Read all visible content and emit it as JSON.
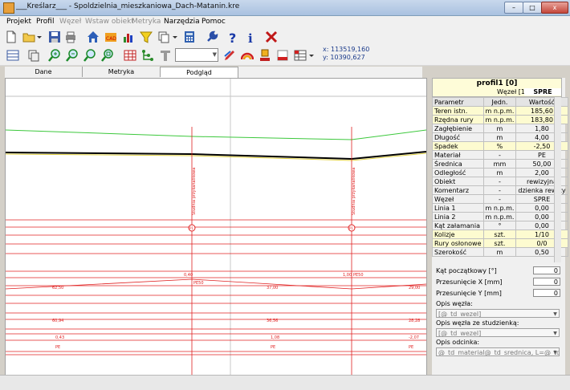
{
  "window": {
    "title": "___Kreślarz___ - Spoldzielnia_mieszkaniowa_Dach-Matanin.kre",
    "controls": {
      "minimize": "–",
      "maximize": "□",
      "close": "x"
    }
  },
  "menu": [
    {
      "label": "Projekt",
      "enabled": true
    },
    {
      "label": "Profil",
      "enabled": true
    },
    {
      "label": "Węzeł",
      "enabled": false
    },
    {
      "label": "Wstaw obiekt",
      "enabled": false
    },
    {
      "label": "Metryka",
      "enabled": false
    },
    {
      "label": "Narzędzia",
      "enabled": true
    },
    {
      "label": "Pomoc",
      "enabled": true
    }
  ],
  "toolbar1_icons": [
    "new-file-icon",
    "open-folder-icon",
    "dropdown-arrow-icon",
    "save-icon",
    "print-icon",
    "home-icon",
    "cad-icon",
    "bar-chart-icon",
    "filter-funnel-icon",
    "copy-pages-icon",
    "dropdown-arrow-icon",
    "calculator-icon",
    "wrench-icon",
    "help-question-icon",
    "info-icon",
    "delete-x-icon"
  ],
  "toolbar2_icons": [
    "layers-list-icon",
    "window-copy-icon",
    "zoom-in-icon",
    "zoom-out-icon",
    "zoom-fit-icon",
    "zoom-window-icon",
    "table-grid-icon",
    "network-nodes-icon",
    "pipe-t-icon",
    "layer-select-combo",
    "pen-marker-icon",
    "rainbow-icon",
    "node-pin-icon",
    "red-box-icon",
    "red-box-2-icon",
    "grid-settings-icon",
    "dropdown-arrow-icon"
  ],
  "coords": {
    "x": "x: 113519,160",
    "y": "y: 10390,627"
  },
  "tabs": [
    "Dane",
    "Metryka",
    "Podgląd"
  ],
  "profile": {
    "title": "profil1 [0]",
    "node_label": "Węzeł [1]:",
    "node_value": "SPRE",
    "columns": [
      "Parametr",
      "Jedn.",
      "Wartość"
    ],
    "rows": [
      {
        "name": "Teren istn.",
        "unit": "m n.p.m.",
        "value": "185,60",
        "highlight": true
      },
      {
        "name": "Rzędna rury",
        "unit": "m n.p.m.",
        "value": "183,80",
        "highlight": true
      },
      {
        "name": "Zagłębienie",
        "unit": "m",
        "value": "1,80",
        "highlight": false
      },
      {
        "name": "Długość",
        "unit": "m",
        "value": "4,00",
        "highlight": false
      },
      {
        "name": "Spadek",
        "unit": "%",
        "value": "-2,50",
        "highlight": true
      },
      {
        "name": "Materiał",
        "unit": "-",
        "value": "PE",
        "highlight": false
      },
      {
        "name": "Średnica",
        "unit": "mm",
        "value": "50,00",
        "highlight": false
      },
      {
        "name": "Odległość",
        "unit": "m",
        "value": "2,00",
        "highlight": false
      },
      {
        "name": "Obiekt",
        "unit": "-",
        "value": "rewizyjna",
        "highlight": false
      },
      {
        "name": "Komentarz",
        "unit": "-",
        "value": "dzienka rewizy",
        "highlight": false
      },
      {
        "name": "Węzeł",
        "unit": "-",
        "value": "SPRE",
        "highlight": false
      },
      {
        "name": "Linia 1",
        "unit": "m n.p.m.",
        "value": "0,00",
        "highlight": false
      },
      {
        "name": "Linia 2",
        "unit": "m n.p.m.",
        "value": "0,00",
        "highlight": false
      },
      {
        "name": "Kąt załamania",
        "unit": "°",
        "value": "0,00",
        "highlight": false
      },
      {
        "name": "Kolizje",
        "unit": "szt.",
        "value": "1/10",
        "highlight": true
      },
      {
        "name": "Rury osłonowe",
        "unit": "szt.",
        "value": "0/0",
        "highlight": true
      },
      {
        "name": "Szerokość",
        "unit": "m",
        "value": "0,50",
        "highlight": false
      }
    ]
  },
  "form": {
    "start_angle": {
      "label": "Kąt początkowy [°]",
      "value": "0"
    },
    "shift_x": {
      "label": "Przesunięcie X [mm]",
      "value": "0"
    },
    "shift_y": {
      "label": "Przesunięcie Y [mm]",
      "value": "0"
    },
    "node_desc": {
      "label": "Opis węzła:",
      "value": "[@_td_wezel]"
    },
    "node_well_desc": {
      "label": "Opis węzła ze studzienką:",
      "value": "[@_td_wezel]"
    },
    "segment_desc": {
      "label": "Opis odcinka:",
      "value": "@_td_material@_td_srednica, L=@_td_dl"
    }
  },
  "drawing": {
    "nodes": [
      {
        "label": "P1",
        "vert_text": "Studnia przykanalikowa"
      },
      {
        "label": "P1",
        "vert_text": "Studnia przykanalikowa"
      }
    ],
    "band_labels": {
      "row1": [
        "0,40",
        "PE50",
        "1,00",
        "PE50"
      ],
      "row2": [
        "62,50",
        "37,00",
        "29,00"
      ],
      "row3": [
        "60,94",
        "36,56",
        "28,28"
      ],
      "row4": [
        "0,43",
        "1,08",
        "-2,07"
      ],
      "row5": [
        "PE",
        "PE",
        "PE"
      ]
    }
  },
  "colors": {
    "terrain": "#3cc83c",
    "pipe": "#000000",
    "bands": "#e02020",
    "highlight": "#fdfbd0"
  }
}
